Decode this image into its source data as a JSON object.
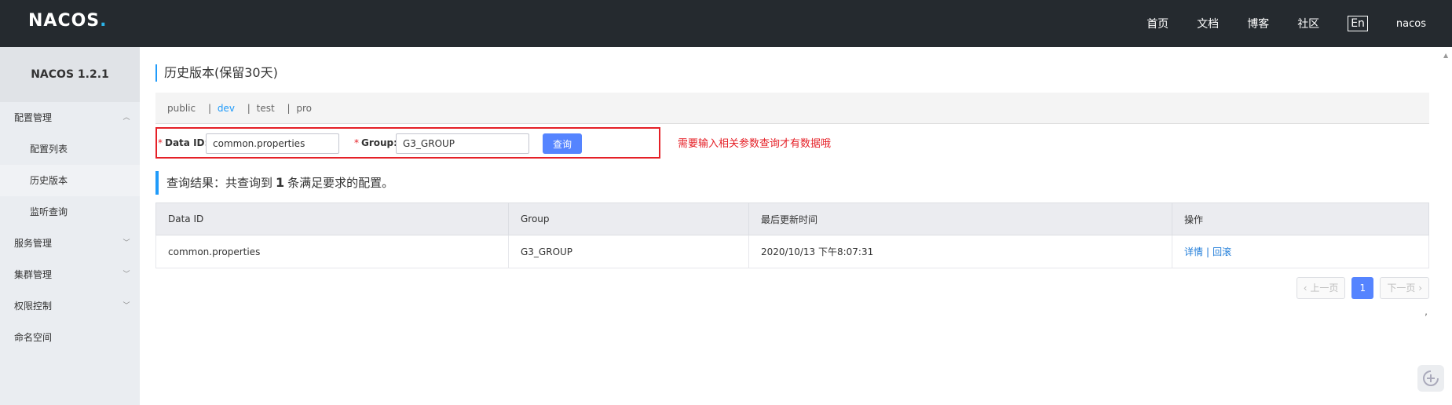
{
  "header": {
    "logo_main": "NACOS",
    "logo_dot": ".",
    "nav": [
      "首页",
      "文档",
      "博客",
      "社区"
    ],
    "lang": "En",
    "user": "nacos"
  },
  "sidebar": {
    "title": "NACOS 1.2.1",
    "items": [
      {
        "label": "配置管理",
        "chevron": "︿",
        "type": "group"
      },
      {
        "label": "配置列表",
        "type": "sub"
      },
      {
        "label": "历史版本",
        "type": "sub-active"
      },
      {
        "label": "监听查询",
        "type": "sub"
      },
      {
        "label": "服务管理",
        "chevron": "﹀",
        "type": "group"
      },
      {
        "label": "集群管理",
        "chevron": "﹀",
        "type": "group"
      },
      {
        "label": "权限控制",
        "chevron": "﹀",
        "type": "group"
      },
      {
        "label": "命名空间",
        "type": "group"
      }
    ]
  },
  "main": {
    "title": "历史版本(保留30天)",
    "namespaces": [
      "public",
      "dev",
      "test",
      "pro"
    ],
    "active_namespace": "dev",
    "search": {
      "dataid_label": "Data ID:",
      "dataid_value": "common.properties",
      "group_label": "Group:",
      "group_value": "G3_GROUP",
      "button": "查询",
      "required_mark": "*"
    },
    "hint": "需要输入相关参数查询才有数据哦",
    "result": {
      "prefix": "查询结果：共查询到",
      "count": "1",
      "suffix": "条满足要求的配置。"
    },
    "table": {
      "headers": [
        "Data ID",
        "Group",
        "最后更新时间",
        "操作"
      ],
      "rows": [
        {
          "dataid": "common.properties",
          "group": "G3_GROUP",
          "time": "2020/10/13 下午8:07:31",
          "op_detail": "详情",
          "op_sep": "|",
          "op_rollback": "回滚"
        }
      ]
    },
    "pager": {
      "prev": "上一页",
      "page": "1",
      "next": "下一页",
      "tick": ","
    }
  },
  "colors": {
    "topbar": "#252a2f",
    "accent": "#209bfa",
    "primary_button": "#5584ff",
    "highlight_red": "#e52027"
  }
}
